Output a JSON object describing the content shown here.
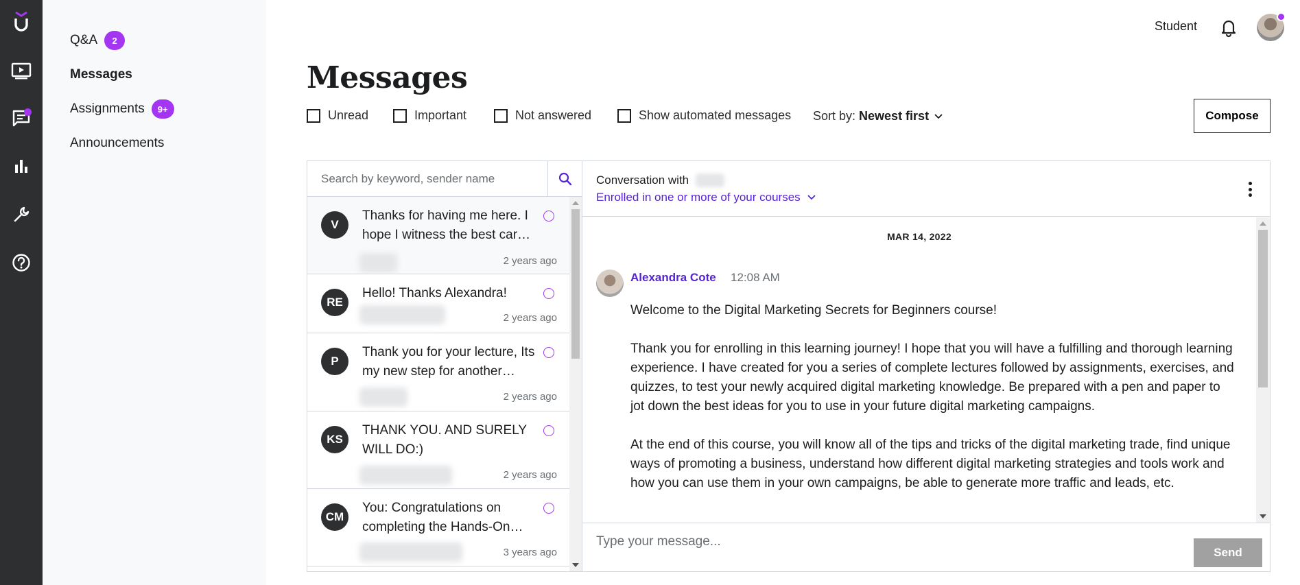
{
  "rail": {
    "logo_text": "U",
    "items": [
      {
        "icon": "play-screen-icon"
      },
      {
        "icon": "messages-icon",
        "has_dot": true
      },
      {
        "icon": "bar-chart-icon"
      },
      {
        "icon": "wrench-icon"
      },
      {
        "icon": "help-icon"
      }
    ]
  },
  "subnav": {
    "items": [
      {
        "label": "Q&A",
        "badge": "2"
      },
      {
        "label": "Messages"
      },
      {
        "label": "Assignments",
        "badge": "9+"
      },
      {
        "label": "Announcements"
      }
    ]
  },
  "header": {
    "student_link": "Student"
  },
  "page": {
    "title": "Messages"
  },
  "filters": {
    "unread": "Unread",
    "important": "Important",
    "not_answered": "Not answered",
    "automated": "Show automated messages",
    "sort_label": "Sort by:",
    "sort_value": "Newest first",
    "compose": "Compose"
  },
  "search": {
    "placeholder": "Search by keyword, sender name"
  },
  "conversations": [
    {
      "initials": "V",
      "text": "Thanks for having me here. I hope I witness the best career opportunities",
      "time": "2 years ago"
    },
    {
      "initials": "RE",
      "text": "Hello! Thanks Alexandra!",
      "time": "2 years ago"
    },
    {
      "initials": "P",
      "text": "Thank you for your lecture, Its my new step for another beginning",
      "time": "2 years ago"
    },
    {
      "initials": "KS",
      "text": "THANK YOU. AND SURELY WILL DO:)",
      "time": "2 years ago"
    },
    {
      "initials": "CM",
      "text": "You: Congratulations on completing the Hands-On course",
      "time": "3 years ago"
    }
  ],
  "conversation": {
    "with_label": "Conversation with",
    "enrolled": "Enrolled in one or more of your courses",
    "date": "MAR 14, 2022",
    "sender": "Alexandra Cote",
    "time": "12:08 AM",
    "paragraphs": [
      "Welcome to the Digital Marketing Secrets for Beginners course!",
      "Thank you for enrolling in this learning journey! I hope that you will have a fulfilling and thorough learning experience. I have created for you a series of complete lectures followed by assignments, exercises, and quizzes, to test your newly acquired digital marketing knowledge. Be prepared with a pen and paper to jot down the best ideas for you to use in your future digital marketing campaigns.",
      "At the end of this course, you will know all of the tips and tricks of the digital marketing trade, find unique ways of promoting a business, understand how different digital marketing strategies and tools work and how you can use them in your own campaigns, be able to generate more traffic and leads, etc."
    ]
  },
  "composer": {
    "placeholder": "Type your message...",
    "send": "Send"
  },
  "colors": {
    "accent_purple": "#a435f0",
    "link_purple": "#5624d0",
    "rail_bg": "#2d2f31"
  }
}
